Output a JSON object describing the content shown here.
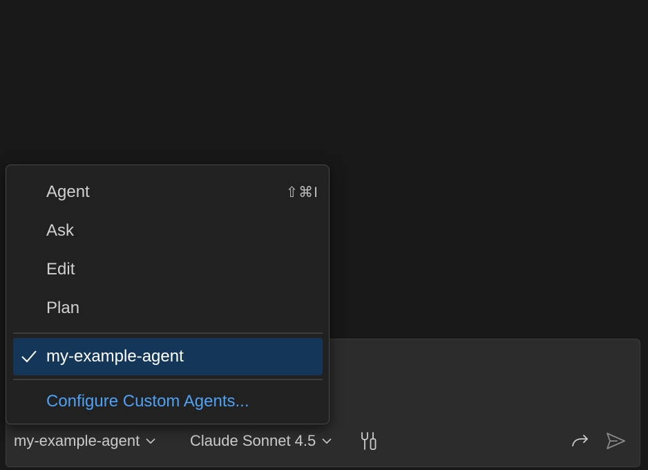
{
  "menu": {
    "items": [
      {
        "label": "Agent",
        "shortcut": "⇧⌘I"
      },
      {
        "label": "Ask"
      },
      {
        "label": "Edit"
      },
      {
        "label": "Plan"
      }
    ],
    "custom_agent": {
      "label": "my-example-agent",
      "selected": true
    },
    "configure_label": "Configure Custom Agents..."
  },
  "toolbar": {
    "agent_picker": "my-example-agent",
    "model_picker": "Claude Sonnet 4.5",
    "icons": [
      "tools-icon",
      "redo-icon",
      "send-icon"
    ]
  },
  "colors": {
    "background": "#181818",
    "menu_bg": "#212121",
    "selected_bg": "#133659",
    "link": "#4ea1f5",
    "text": "#cccccc"
  }
}
